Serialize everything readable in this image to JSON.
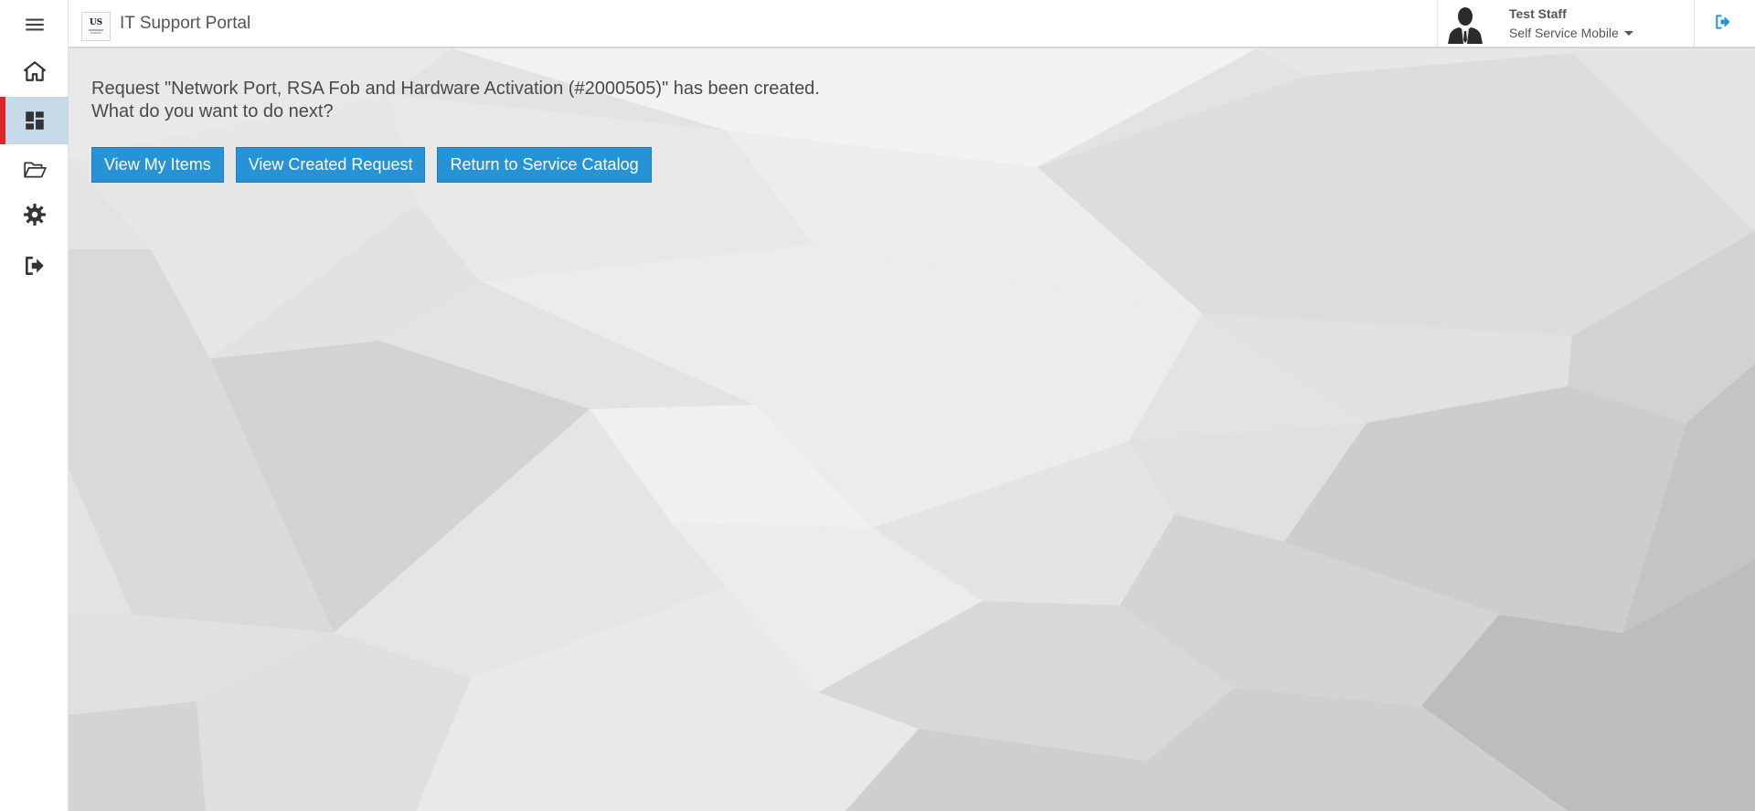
{
  "sidebar": {
    "items": [
      {
        "name": "menu",
        "icon": "hamburger-icon",
        "active": false
      },
      {
        "name": "home",
        "icon": "home-icon",
        "active": false
      },
      {
        "name": "dashboard",
        "icon": "dashboard-icon",
        "active": true
      },
      {
        "name": "folder",
        "icon": "folder-open-icon",
        "active": false
      },
      {
        "name": "settings",
        "icon": "gear-icon",
        "active": false
      },
      {
        "name": "logout",
        "icon": "sign-out-icon",
        "active": false
      }
    ],
    "active_color": "#c7daea",
    "active_marker_color": "#d9262b"
  },
  "header": {
    "logo_text": "US",
    "title": "IT Support Portal",
    "user": {
      "name": "Test Staff",
      "role": "Self Service Mobile"
    },
    "logout_icon": "sign-out-icon"
  },
  "main": {
    "message_line1": "Request \"Network Port, RSA Fob and Hardware Activation (#2000505)\" has been created.",
    "message_line2": "What do you want to do next?",
    "buttons": [
      {
        "label": "View My Items"
      },
      {
        "label": "View Created Request"
      },
      {
        "label": "Return to Service Catalog"
      }
    ],
    "button_color": "#2593d6"
  }
}
